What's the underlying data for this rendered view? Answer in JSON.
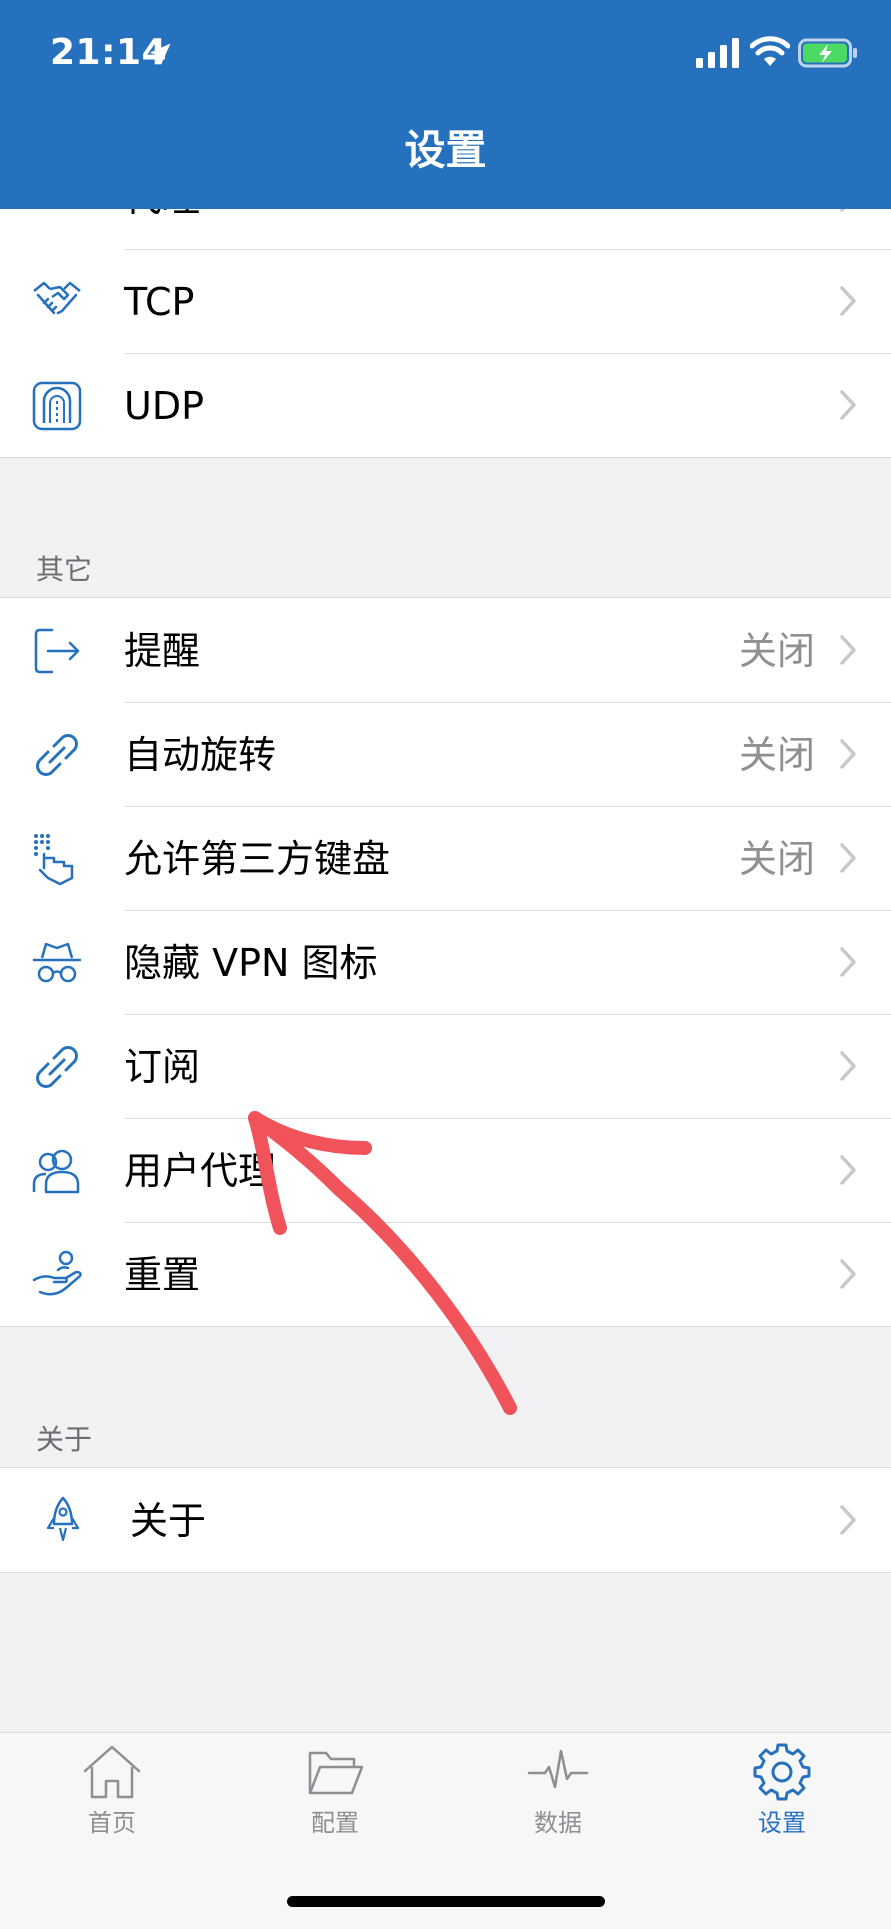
{
  "status_bar": {
    "time": "21:14"
  },
  "nav": {
    "title": "设置"
  },
  "groups": {
    "network": {
      "items": [
        {
          "label": "代理",
          "icon": "shield-icon"
        },
        {
          "label": "TCP",
          "icon": "handshake-icon"
        },
        {
          "label": "UDP",
          "icon": "tunnel-icon"
        }
      ]
    },
    "other": {
      "header": "其它",
      "items": [
        {
          "label": "提醒",
          "value": "关闭",
          "icon": "logout-arrow-icon"
        },
        {
          "label": "自动旋转",
          "value": "关闭",
          "icon": "link-icon"
        },
        {
          "label": "允许第三方键盘",
          "value": "关闭",
          "icon": "tap-keyboard-icon"
        },
        {
          "label": "隐藏 VPN 图标",
          "icon": "incognito-icon"
        },
        {
          "label": "订阅",
          "icon": "link-icon"
        },
        {
          "label": "用户代理",
          "icon": "users-icon"
        },
        {
          "label": "重置",
          "icon": "hand-coin-icon"
        }
      ]
    },
    "about": {
      "header": "关于",
      "items": [
        {
          "label": "关于",
          "icon": "rocket-icon"
        }
      ]
    }
  },
  "tabbar": {
    "tabs": [
      {
        "label": "首页",
        "icon": "home-icon",
        "active": false
      },
      {
        "label": "配置",
        "icon": "folder-icon",
        "active": false
      },
      {
        "label": "数据",
        "icon": "pulse-icon",
        "active": false
      },
      {
        "label": "设置",
        "icon": "gear-icon",
        "active": true
      }
    ]
  },
  "colors": {
    "accent": "#2671be",
    "annotation": "#f0545a",
    "secondary_text": "#8e8e93",
    "background": "#f2f2f4"
  }
}
